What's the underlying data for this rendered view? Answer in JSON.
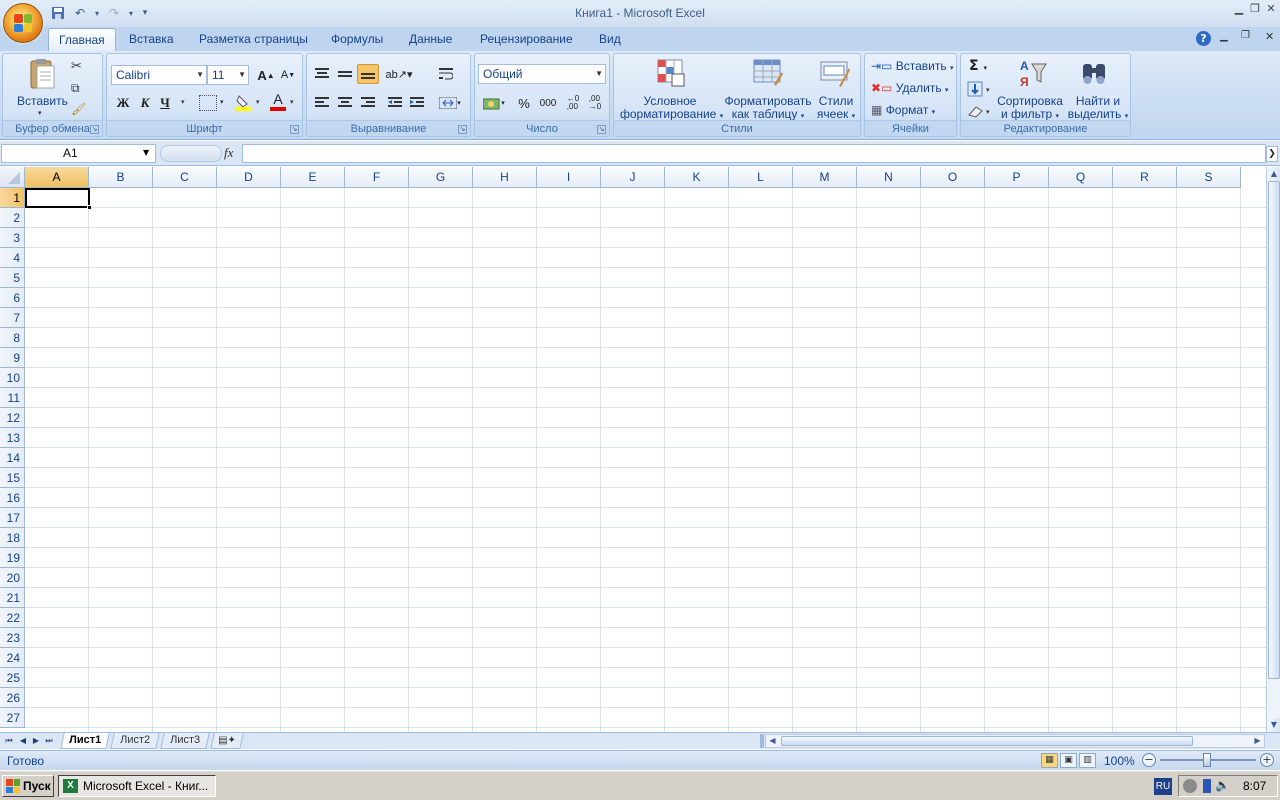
{
  "app": {
    "window_title": "Книга1 - Microsoft Excel"
  },
  "tabs": [
    {
      "label": "Главная",
      "active": true
    },
    {
      "label": "Вставка"
    },
    {
      "label": "Разметка страницы"
    },
    {
      "label": "Формулы"
    },
    {
      "label": "Данные"
    },
    {
      "label": "Рецензирование"
    },
    {
      "label": "Вид"
    }
  ],
  "ribbon": {
    "clipboard": {
      "label": "Буфер обмена",
      "paste": "Вставить"
    },
    "font": {
      "label": "Шрифт",
      "name": "Calibri",
      "size": "11",
      "bold": "Ж",
      "italic": "К",
      "underline": "Ч"
    },
    "alignment": {
      "label": "Выравнивание"
    },
    "number": {
      "label": "Число",
      "format": "Общий",
      "percent": "%",
      "thousands": "000"
    },
    "styles": {
      "label": "Стили",
      "cond_l1": "Условное",
      "cond_l2": "форматирование",
      "table_l1": "Форматировать",
      "table_l2": "как таблицу",
      "cell_l1": "Стили",
      "cell_l2": "ячеек"
    },
    "cells": {
      "label": "Ячейки",
      "insert": "Вставить",
      "delete": "Удалить",
      "format": "Формат"
    },
    "editing": {
      "label": "Редактирование",
      "sort_l1": "Сортировка",
      "sort_l2": "и фильтр",
      "find_l1": "Найти и",
      "find_l2": "выделить"
    }
  },
  "formula_bar": {
    "name_box": "A1",
    "fx": "fx",
    "formula": ""
  },
  "columns": [
    "A",
    "B",
    "C",
    "D",
    "E",
    "F",
    "G",
    "H",
    "I",
    "J",
    "K",
    "L",
    "M",
    "N",
    "O",
    "P",
    "Q",
    "R",
    "S"
  ],
  "rows": [
    "1",
    "2",
    "3",
    "4",
    "5",
    "6",
    "7",
    "8",
    "9",
    "10",
    "11",
    "12",
    "13",
    "14",
    "15",
    "16",
    "17",
    "18",
    "19",
    "20",
    "21",
    "22",
    "23",
    "24",
    "25",
    "26",
    "27"
  ],
  "selected_cell": {
    "column": "A",
    "row": "1"
  },
  "sheets": [
    {
      "label": "Лист1",
      "active": true
    },
    {
      "label": "Лист2"
    },
    {
      "label": "Лист3"
    }
  ],
  "status": {
    "text": "Готово",
    "zoom": "100%"
  },
  "taskbar": {
    "start": "Пуск",
    "task": "Microsoft Excel - Книг...",
    "lang": "RU",
    "clock": "8:07"
  },
  "colors": {
    "accent": "#15428b",
    "selection_header": "#f1c15f",
    "gridline": "#dae2ec"
  }
}
